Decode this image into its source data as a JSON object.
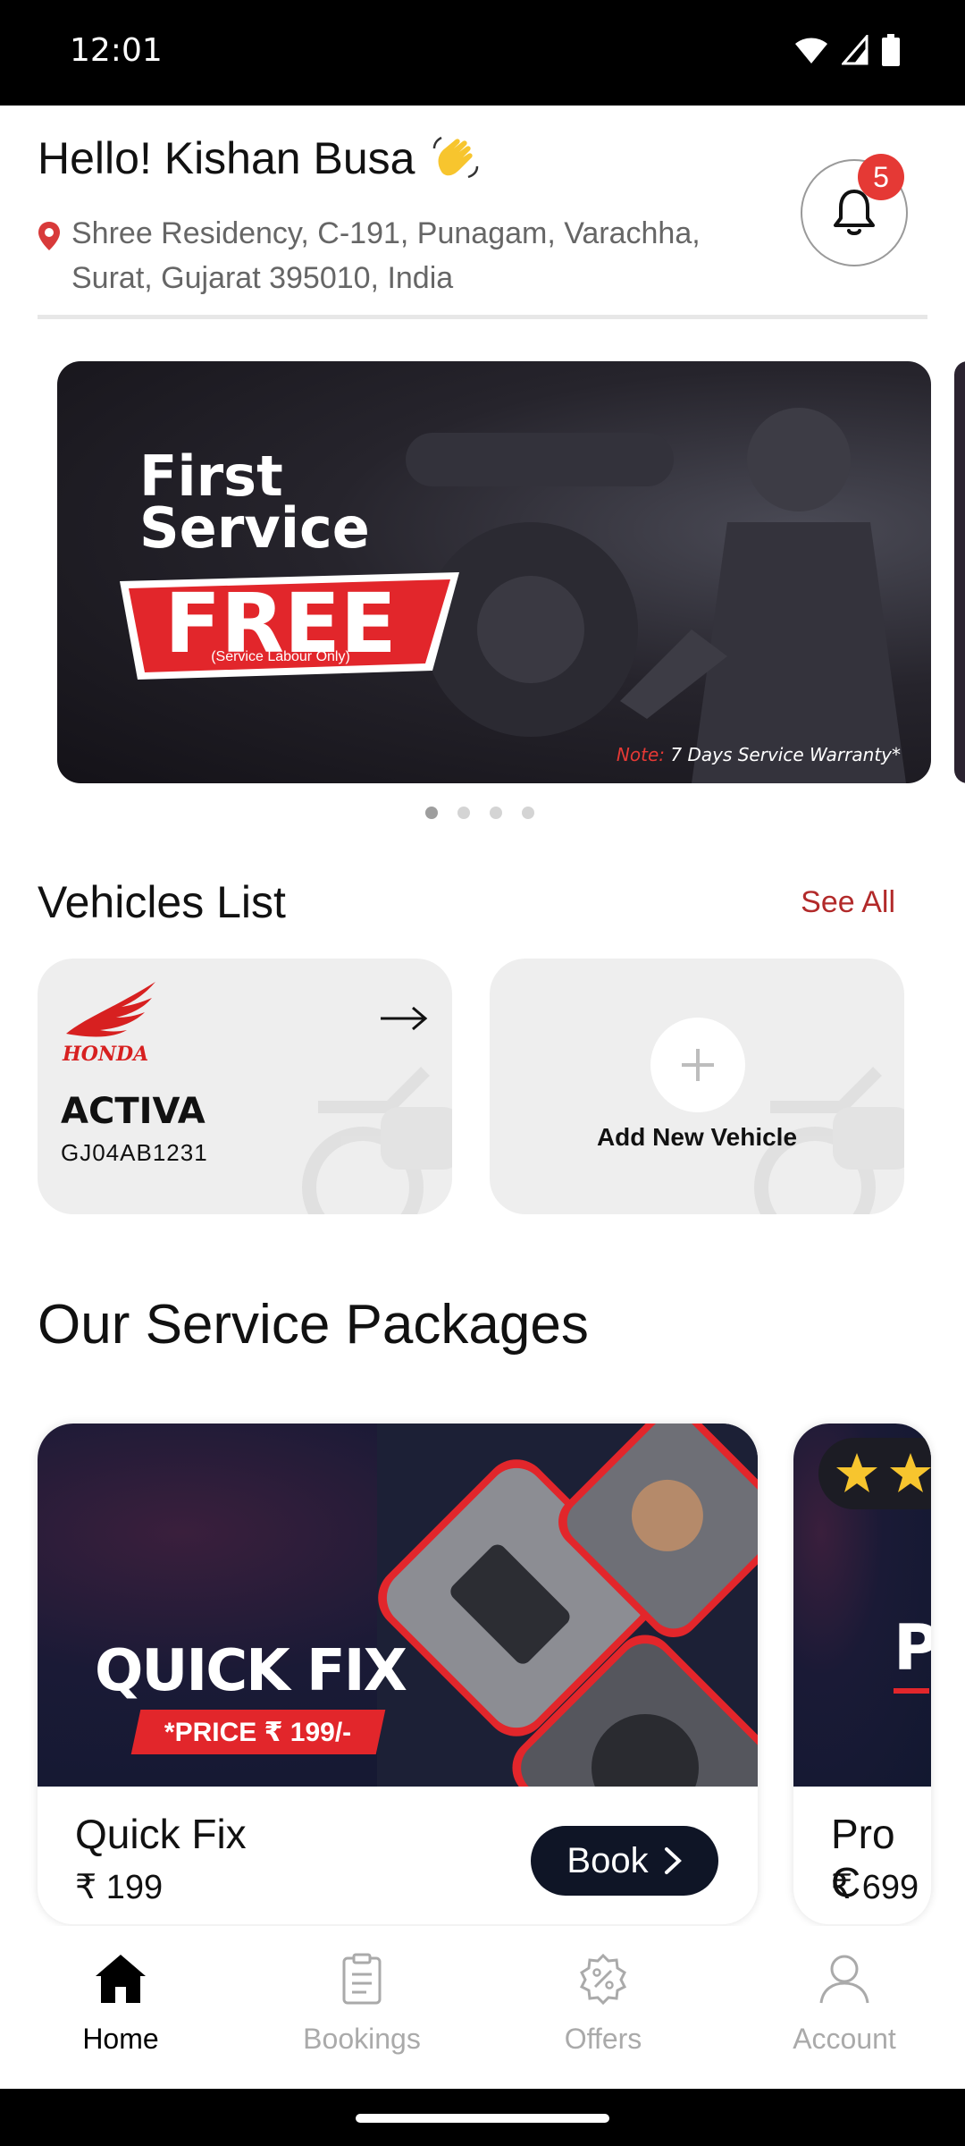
{
  "status_bar": {
    "time": "12:01"
  },
  "header": {
    "greeting": "Hello! Kishan Busa",
    "address_line1": "Shree Residency, C-191, Punagam, Varachha,",
    "address_line2": "Surat, Gujarat 395010, India",
    "notification_count": "5"
  },
  "banner": {
    "title_line1": "First",
    "title_line2": "Service",
    "highlight": "FREE",
    "highlight_sub": "(Service Labour Only)",
    "note_label": "Note:",
    "note_text": "7 Days Service Warranty*",
    "slide_count": 4,
    "active_slide": 0
  },
  "vehicles": {
    "title": "Vehicles List",
    "see_all": "See All",
    "items": [
      {
        "brand": "HONDA",
        "model": "ACTIVA",
        "plate": "GJ04AB1231"
      }
    ],
    "add_label": "Add New Vehicle"
  },
  "packages": {
    "title": "Our Service Packages",
    "items": [
      {
        "image_title": "QUICK FIX",
        "image_price": "*PRICE ₹ 199/-",
        "name": "Quick Fix",
        "price": "₹ 199",
        "book_label": "Book"
      },
      {
        "image_title": "P",
        "name": "Pro C",
        "price": "₹ 699"
      }
    ]
  },
  "bottom_nav": {
    "items": [
      {
        "label": "Home",
        "icon": "home-icon",
        "active": true
      },
      {
        "label": "Bookings",
        "icon": "clipboard-icon",
        "active": false
      },
      {
        "label": "Offers",
        "icon": "discount-badge-icon",
        "active": false
      },
      {
        "label": "Account",
        "icon": "user-icon",
        "active": false
      }
    ]
  },
  "colors": {
    "accent_red": "#e2262b",
    "see_all": "#b22a2a",
    "dark_button": "#0f1526",
    "badge": "#e53935"
  }
}
